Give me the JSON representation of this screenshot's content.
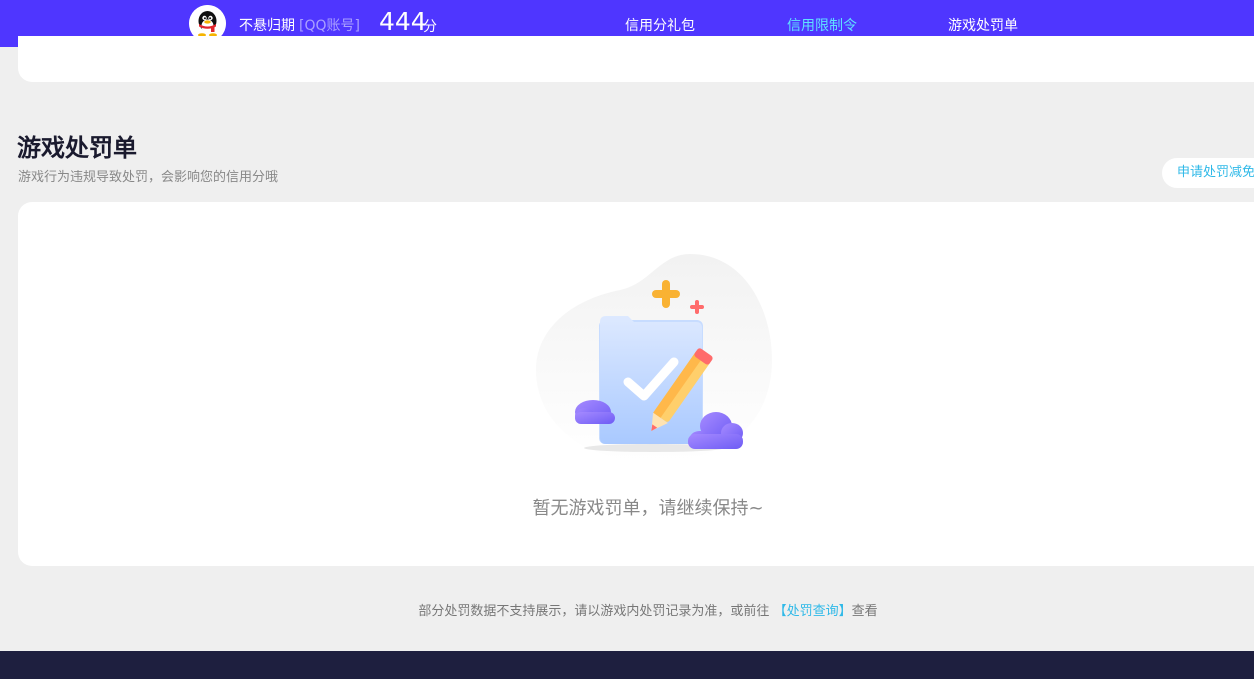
{
  "header": {
    "username": "不悬归期",
    "account_tag": "[QQ账号]",
    "score": "444",
    "score_unit": "分",
    "nav": [
      {
        "label": "信用分礼包"
      },
      {
        "label": "信用限制令"
      },
      {
        "label": "游戏处罚单"
      }
    ],
    "active_nav_color": "#5fe3ff",
    "brand_color": "#4f36ff"
  },
  "section": {
    "title": "游戏处罚单",
    "subtitle": "游戏行为违规导致处罚，会影响您的信用分哦",
    "apply_button": "申请处罚减免"
  },
  "empty_state": {
    "message": "暂无游戏罚单，请继续保持~",
    "illustration": "document-check-pencil-illustration"
  },
  "footer": {
    "note_prefix": "部分处罚数据不支持展示，请以游戏内处罚记录为准，或前往",
    "link_label": "【处罚查询】",
    "note_suffix": "查看"
  }
}
